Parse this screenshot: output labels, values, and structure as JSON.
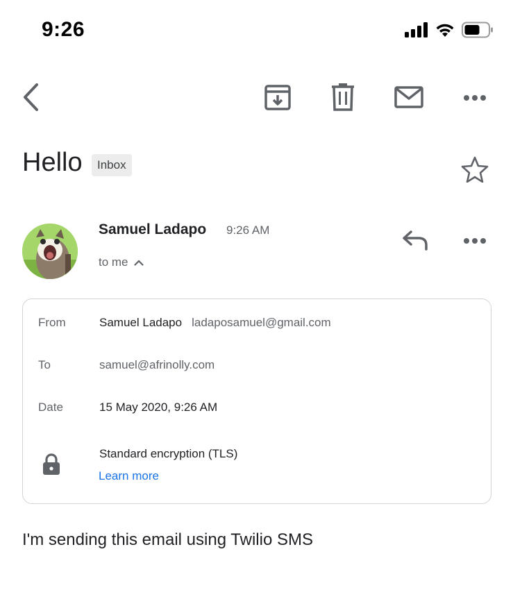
{
  "status_bar": {
    "time": "9:26",
    "icons": [
      "signal-icon",
      "wifi-icon",
      "battery-icon"
    ]
  },
  "toolbar": {
    "icons": [
      "back-arrow-icon",
      "archive-icon",
      "trash-icon",
      "mail-icon",
      "more-icon"
    ]
  },
  "message": {
    "subject": "Hello",
    "label": "Inbox",
    "sender_name": "Samuel Ladapo",
    "time": "9:26 AM",
    "recipient_summary": "to me"
  },
  "details": {
    "from_label": "From",
    "from_name": "Samuel Ladapo",
    "from_email": "ladaposamuel@gmail.com",
    "to_label": "To",
    "to_email": "samuel@afrinolly.com",
    "date_label": "Date",
    "date_value": "15 May 2020, 9:26 AM",
    "encryption": "Standard encryption (TLS)",
    "learn_more": "Learn more"
  },
  "body": {
    "text": "I'm sending this email using Twilio SMS"
  },
  "colors": {
    "link": "#1a73e8",
    "icon_gray": "#5f6368",
    "chip_bg": "#ececec",
    "border": "#d3d3d3"
  }
}
